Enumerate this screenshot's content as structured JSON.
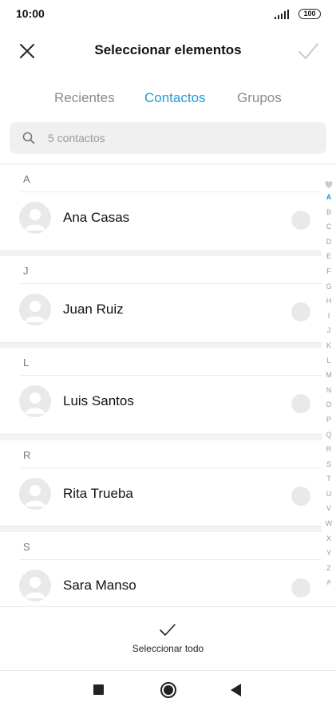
{
  "status_bar": {
    "time": "10:00",
    "battery": "100",
    "signal_icon": "signal-icon"
  },
  "header": {
    "title": "Seleccionar elementos",
    "close_icon": "close-icon",
    "confirm_icon": "check-icon"
  },
  "tabs": [
    {
      "label": "Recientes",
      "active": false
    },
    {
      "label": "Contactos",
      "active": true
    },
    {
      "label": "Grupos",
      "active": false
    }
  ],
  "search": {
    "placeholder": "5 contactos",
    "value": ""
  },
  "contacts": [
    {
      "letter": "A",
      "name": "Ana Casas"
    },
    {
      "letter": "J",
      "name": "Juan Ruiz"
    },
    {
      "letter": "L",
      "name": "Luis Santos"
    },
    {
      "letter": "R",
      "name": "Rita Trueba"
    },
    {
      "letter": "S",
      "name": "Sara Manso"
    }
  ],
  "index_bar": [
    "A",
    "B",
    "C",
    "D",
    "E",
    "F",
    "G",
    "H",
    "I",
    "J",
    "K",
    "L",
    "M",
    "N",
    "O",
    "P",
    "Q",
    "R",
    "S",
    "T",
    "U",
    "V",
    "W",
    "X",
    "Y",
    "Z",
    "#"
  ],
  "index_active": "A",
  "footer": {
    "select_all_label": "Seleccionar todo"
  },
  "colors": {
    "accent": "#1e9bd7",
    "text": "#111111",
    "muted": "#8a8a8a"
  }
}
